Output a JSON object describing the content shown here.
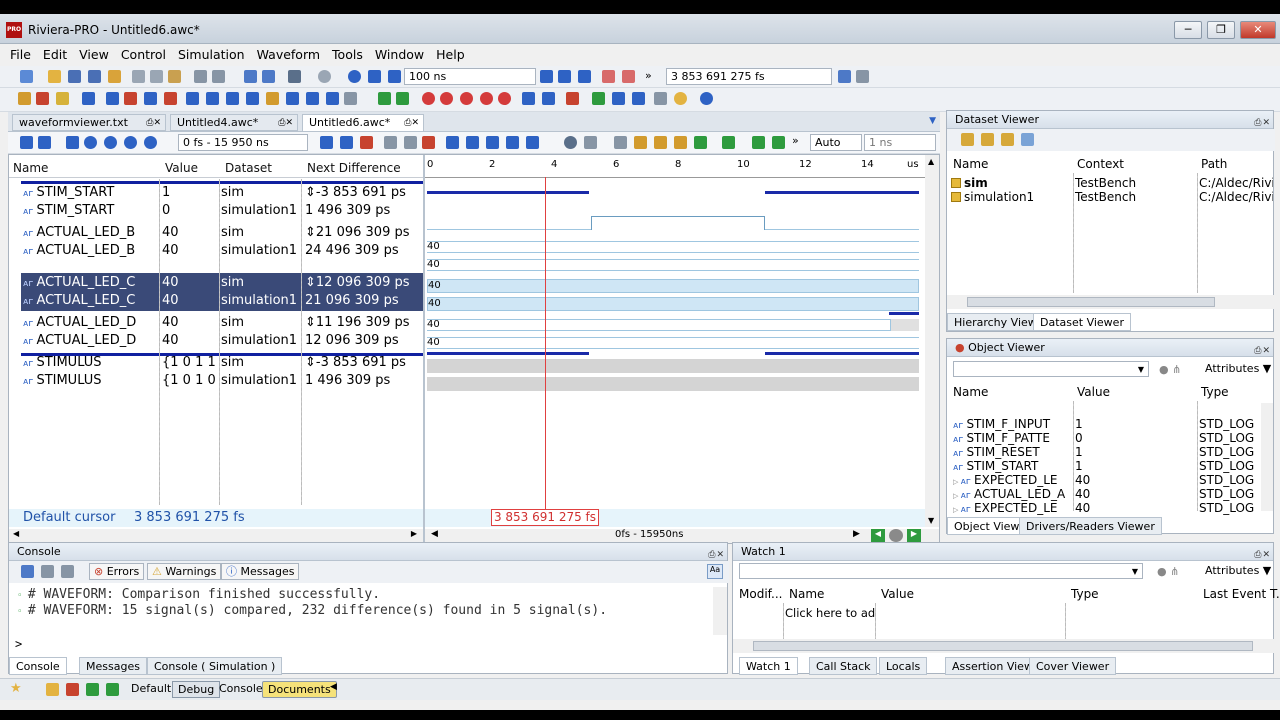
{
  "window": {
    "title": "Riviera-PRO - Untitled6.awc*",
    "logo": "PRO"
  },
  "menu": [
    "File",
    "Edit",
    "View",
    "Control",
    "Simulation",
    "Waveform",
    "Tools",
    "Window",
    "Help"
  ],
  "toolbar": {
    "sim_step": "100 ns",
    "sim_time": "3 853 691 275 fs"
  },
  "doc_tabs": [
    "waveformviewer.txt",
    "Untitled4.awc*",
    "Untitled6.awc*"
  ],
  "wave_toolbar": {
    "range": "0 fs - 15 950 ns",
    "zoom_mode": "Auto",
    "zoom_step": "1 ns"
  },
  "wave": {
    "headers": {
      "name": "Name",
      "value": "Value",
      "dataset": "Dataset",
      "next_diff": "Next Difference"
    },
    "ruler": [
      "0",
      "2",
      "4",
      "6",
      "8",
      "10",
      "12",
      "14",
      "us"
    ],
    "signals": [
      {
        "name": "STIM_START",
        "value": "1",
        "dataset": "sim",
        "next": "-3 853 691 ps"
      },
      {
        "name": "STIM_START",
        "value": "0",
        "dataset": "simulation1",
        "next": "1 496 309 ps"
      },
      {
        "name": "ACTUAL_LED_B",
        "value": "40",
        "dataset": "sim",
        "next": "21 096 309 ps"
      },
      {
        "name": "ACTUAL_LED_B",
        "value": "40",
        "dataset": "simulation1",
        "next": "24 496 309 ps"
      },
      {
        "name": "ACTUAL_LED_C",
        "value": "40",
        "dataset": "sim",
        "next": "12 096 309 ps"
      },
      {
        "name": "ACTUAL_LED_C",
        "value": "40",
        "dataset": "simulation1",
        "next": "21 096 309 ps"
      },
      {
        "name": "ACTUAL_LED_D",
        "value": "40",
        "dataset": "sim",
        "next": "11 196 309 ps"
      },
      {
        "name": "ACTUAL_LED_D",
        "value": "40",
        "dataset": "simulation1",
        "next": "12 096 309 ps"
      },
      {
        "name": "STIMULUS",
        "value": "{1 0 1 1 ·",
        "dataset": "sim",
        "next": "-3 853 691 ps"
      },
      {
        "name": "STIMULUS",
        "value": "{1 0 1 0 ·",
        "dataset": "simulation1",
        "next": "1 496 309 ps"
      }
    ],
    "bus_labels": [
      "40",
      "40",
      "40",
      "40",
      "40",
      "40"
    ],
    "cursor_label": "Default cursor",
    "cursor_time": "3 853 691 275 fs",
    "scroll_range": "0fs - 15950ns"
  },
  "dataset_viewer": {
    "title": "Dataset Viewer",
    "headers": [
      "Name",
      "Context",
      "Path"
    ],
    "rows": [
      {
        "name": "sim",
        "context": "TestBench",
        "path": "C:/Aldec/Rivie"
      },
      {
        "name": "simulation1",
        "context": "TestBench",
        "path": "C:/Aldec/Rivie"
      }
    ],
    "tabs": [
      "Hierarchy Viewer",
      "Dataset Viewer"
    ]
  },
  "object_viewer": {
    "title": "Object Viewer",
    "attributes_label": "Attributes",
    "headers": [
      "Name",
      "Value",
      "Type"
    ],
    "rows": [
      {
        "name": "STIM_F_INPUT",
        "value": "1",
        "type": "STD_LOG"
      },
      {
        "name": "STIM_F_PATTE",
        "value": "0",
        "type": "STD_LOG"
      },
      {
        "name": "STIM_RESET",
        "value": "1",
        "type": "STD_LOG"
      },
      {
        "name": "STIM_START",
        "value": "1",
        "type": "STD_LOG"
      },
      {
        "name": "EXPECTED_LE",
        "value": "40",
        "type": "STD_LOG"
      },
      {
        "name": "ACTUAL_LED_A",
        "value": "40",
        "type": "STD_LOG"
      },
      {
        "name": "EXPECTED_LE",
        "value": "40",
        "type": "STD_LOG"
      }
    ],
    "tabs": [
      "Object Viewer",
      "Drivers/Readers Viewer"
    ]
  },
  "console": {
    "title": "Console",
    "filters": [
      "Errors",
      "Warnings",
      "Messages"
    ],
    "lines": [
      "# WAVEFORM: Comparison finished successfully.",
      "# WAVEFORM: 15 signal(s) compared, 232 difference(s) found in 5 signal(s)."
    ],
    "prompt": ">",
    "tabs": [
      "Console",
      "Messages",
      "Console ( Simulation )"
    ]
  },
  "watch": {
    "title": "Watch 1",
    "attributes_label": "Attributes",
    "headers": [
      "Modif...",
      "Name",
      "Value",
      "Type",
      "Last Event T..."
    ],
    "placeholder": "Click here to ad",
    "tabs": [
      "Watch 1",
      "Call Stack",
      "Locals",
      "Assertion Viewer",
      "Cover Viewer"
    ]
  },
  "layout_bar": [
    "Default",
    "Debug",
    "Console",
    "Documents"
  ]
}
